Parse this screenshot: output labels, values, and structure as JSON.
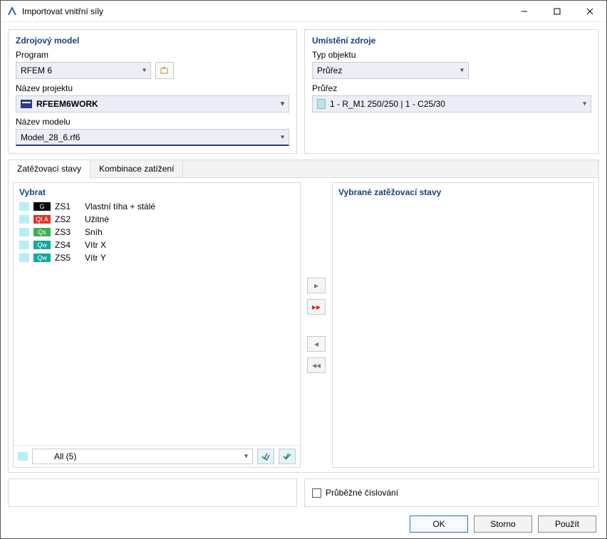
{
  "window": {
    "title": "Importovat vnitřní síly"
  },
  "source": {
    "section_title": "Zdrojový model",
    "program_label": "Program",
    "program_value": "RFEM 6",
    "project_label": "Název projektu",
    "project_value": "RFEEM6WORK",
    "model_label": "Název modelu",
    "model_value": "Model_28_6.rf6"
  },
  "location": {
    "section_title": "Umístění zdroje",
    "objtype_label": "Typ objektu",
    "objtype_value": "Průřez",
    "cs_label": "Průřez",
    "cs_value": "1 - R_M1 250/250 | 1 - C25/30"
  },
  "tabs": {
    "loadcases": "Zatěžovací stavy",
    "combinations": "Kombinace zatížení"
  },
  "loadcases": {
    "select_title": "Vybrat",
    "selected_title": "Vybrané zatěžovací stavy",
    "filter_value": "All (5)",
    "items": [
      {
        "badge": "G",
        "badge_bg": "#000000",
        "code": "ZS1",
        "desc": "Vlastní tíha + stálé"
      },
      {
        "badge": "QI A",
        "badge_bg": "#e0332a",
        "code": "ZS2",
        "desc": "Užitné"
      },
      {
        "badge": "Qs",
        "badge_bg": "#3fae56",
        "code": "ZS3",
        "desc": "Sníh"
      },
      {
        "badge": "Qw",
        "badge_bg": "#15a79c",
        "code": "ZS4",
        "desc": "Vítr X"
      },
      {
        "badge": "Qw",
        "badge_bg": "#15a79c",
        "code": "ZS5",
        "desc": "Vítr Y"
      }
    ]
  },
  "options": {
    "continuous_numbering": "Průběžné číslování"
  },
  "buttons": {
    "ok": "OK",
    "cancel": "Storno",
    "apply": "Použít"
  }
}
